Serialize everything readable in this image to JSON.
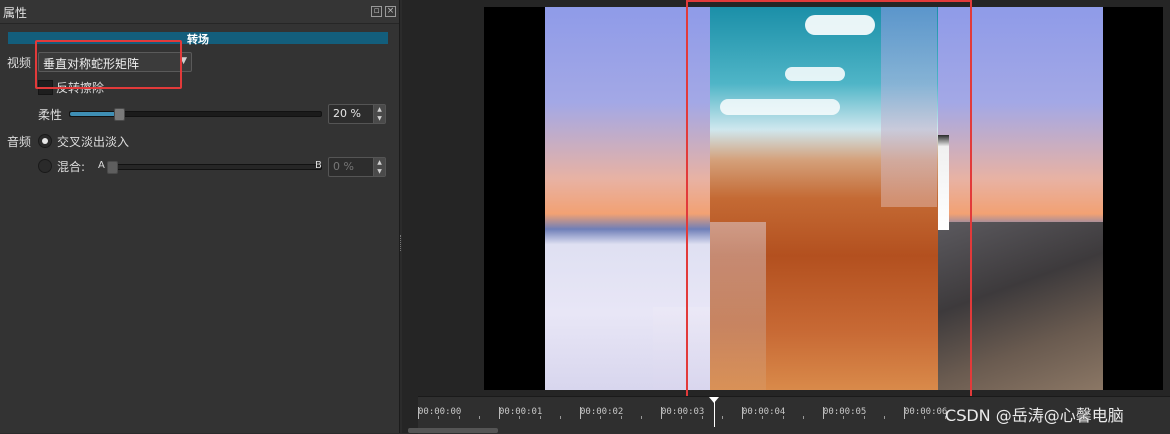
{
  "panel": {
    "title": "属性",
    "float_icon": "float-icon",
    "close_icon": "close-icon"
  },
  "section": {
    "title": "转场"
  },
  "video": {
    "label": "视频",
    "transition_selected": "垂直对称蛇形矩阵",
    "reverse_label": "反转擦除",
    "softness_label": "柔性",
    "softness_value": "20 %",
    "softness_fraction": 0.2
  },
  "audio": {
    "label": "音频",
    "crossfade_label": "交叉淡出淡入",
    "mix_label": "混合:",
    "mix_a": "A",
    "mix_b": "B",
    "mix_value": "0 %",
    "mix_fraction": 0.0
  },
  "timeline": {
    "ticks": [
      "00:00:00",
      "00:00:01",
      "00:00:02",
      "00:00:03",
      "00:00:04",
      "00:00:05",
      "00:00:06"
    ],
    "playhead_icon": "playhead-icon"
  },
  "watermark": "CSDN @岳涛@心馨电脑",
  "colors": {
    "accent": "#135e7c",
    "slider_fill": "#3f8fb5",
    "highlight": "#e23a3a"
  }
}
